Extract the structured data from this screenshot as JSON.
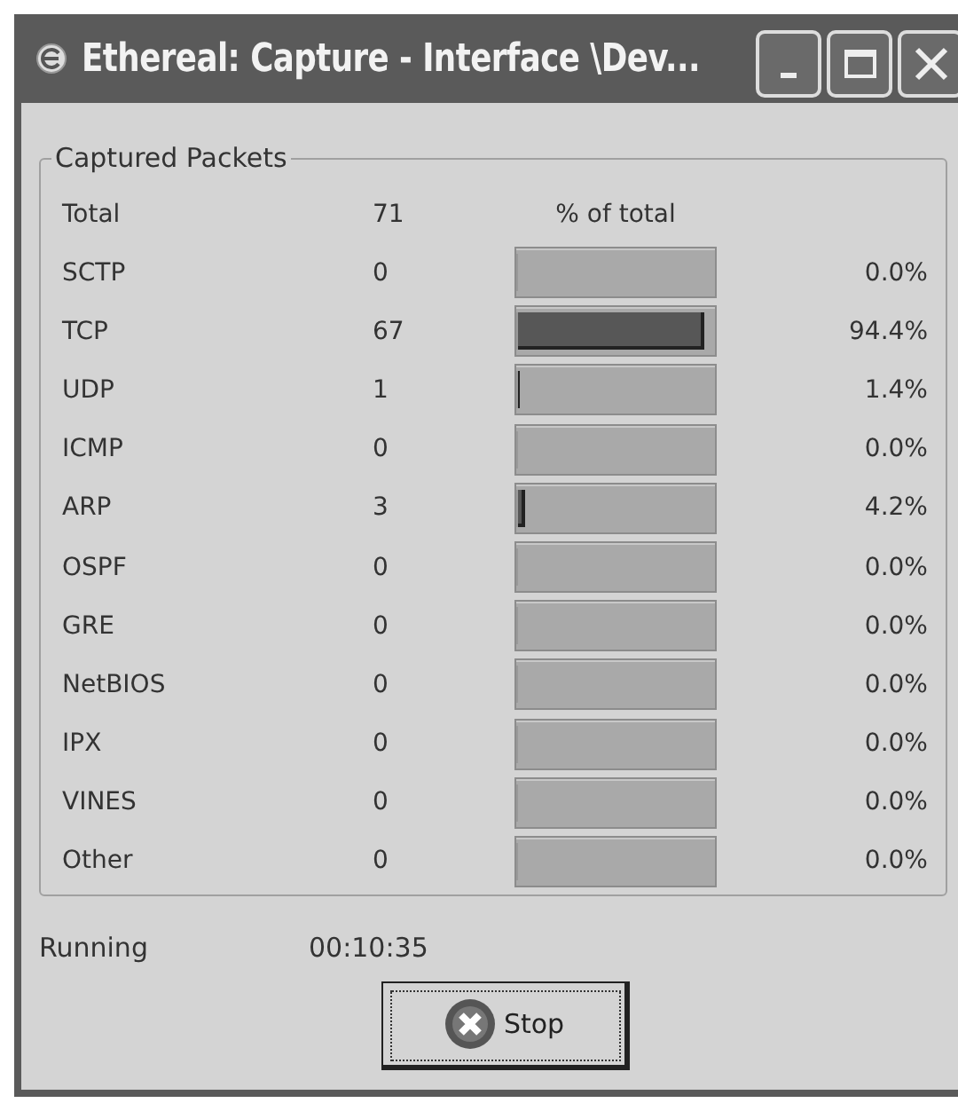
{
  "window": {
    "title": "Ethereal: Capture - Interface \\Dev..."
  },
  "group": {
    "title": "Captured Packets",
    "total": {
      "label": "Total",
      "count": "71",
      "header": "% of total"
    },
    "rows": [
      {
        "name": "SCTP",
        "count": "0",
        "level": 0,
        "percent": "0.0%"
      },
      {
        "name": "TCP",
        "count": "67",
        "level": 0.944,
        "percent": "94.4%"
      },
      {
        "name": "UDP",
        "count": "1",
        "level": 0.014,
        "percent": "1.4%"
      },
      {
        "name": "ICMP",
        "count": "0",
        "level": 0,
        "percent": "0.0%"
      },
      {
        "name": "ARP",
        "count": "3",
        "level": 0.042,
        "percent": "4.2%"
      },
      {
        "name": "OSPF",
        "count": "0",
        "level": 0,
        "percent": "0.0%"
      },
      {
        "name": "GRE",
        "count": "0",
        "level": 0,
        "percent": "0.0%"
      },
      {
        "name": "NetBIOS",
        "count": "0",
        "level": 0,
        "percent": "0.0%"
      },
      {
        "name": "IPX",
        "count": "0",
        "level": 0,
        "percent": "0.0%"
      },
      {
        "name": "VINES",
        "count": "0",
        "level": 0,
        "percent": "0.0%"
      },
      {
        "name": "Other",
        "count": "0",
        "level": 0,
        "percent": "0.0%"
      }
    ]
  },
  "status": {
    "label": "Running",
    "time": "00:10:35"
  },
  "button": {
    "label": "Stop"
  }
}
